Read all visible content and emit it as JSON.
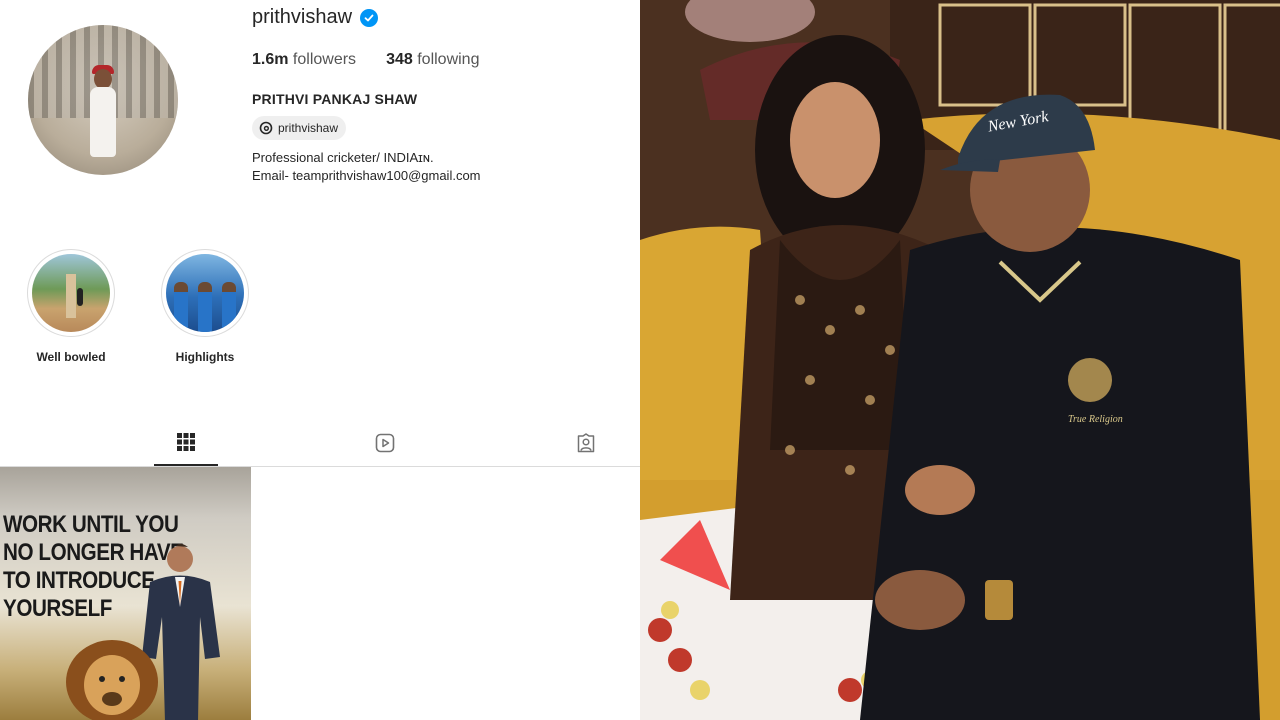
{
  "profile": {
    "username": "prithvishaw",
    "stats": {
      "followers_count": "1.6m",
      "followers_label": "followers",
      "following_count": "348",
      "following_label": "following"
    },
    "full_name": "PRITHVI PANKAJ SHAW",
    "threads_handle": "prithvishaw",
    "bio_line1": "Professional cricketer/ INDIAɪɴ.",
    "bio_line2": "Email- teamprithvishaw100@gmail.com"
  },
  "highlights": [
    {
      "label": "Well bowled"
    },
    {
      "label": "Highlights"
    }
  ],
  "tabs": {
    "posts_icon": "grid-icon",
    "reels_icon": "reels-icon",
    "tagged_icon": "tagged-icon"
  },
  "post": {
    "line1": "WORK UNTIL YOU",
    "line2": "NO LONGER HAVE",
    "line3": "TO INTRODUCE",
    "line4": "YOURSELF"
  },
  "photo": {
    "cap_text": "New York",
    "shirt_logo_text": "True Religion"
  },
  "colors": {
    "verified": "#0095f6",
    "text": "#262626",
    "divider": "#dbdbdb"
  }
}
